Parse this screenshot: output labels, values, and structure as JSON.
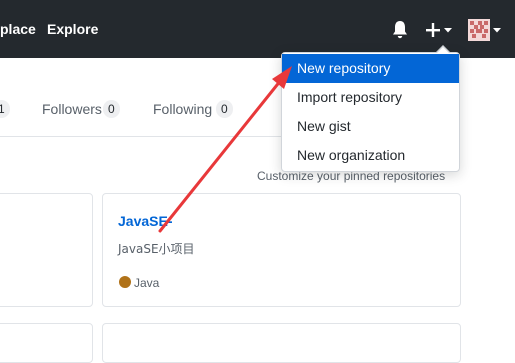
{
  "header": {
    "nav": [
      "place",
      "Explore"
    ],
    "icons": [
      "bell-icon",
      "plus-icon",
      "caret-down-icon",
      "avatar"
    ]
  },
  "profile_tabs": {
    "first_count": "1",
    "followers_label": "Followers",
    "followers_count": "0",
    "following_label": "Following",
    "following_count": "0"
  },
  "pinned": {
    "customize_label": "Customize your pinned repositories",
    "repo": {
      "name": "JavaSE-",
      "description": "JavaSE小项目",
      "language": "Java",
      "language_color": "#b07219"
    }
  },
  "create_menu": {
    "items": [
      "New repository",
      "Import repository",
      "New gist",
      "New organization"
    ],
    "active_item": "New repository"
  },
  "colors": {
    "header_bg": "#24292e",
    "accent": "#0366d6",
    "annotation_arrow": "#e8383a"
  }
}
